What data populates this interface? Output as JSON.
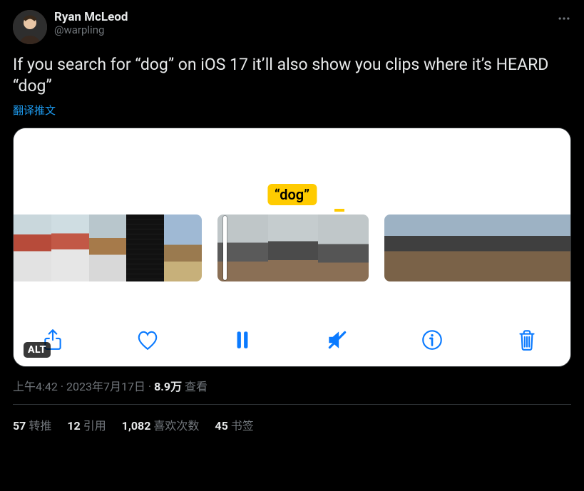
{
  "author": {
    "display_name": "Ryan McLeod",
    "handle": "@warpling"
  },
  "tweet": {
    "text": "If you search for “dog” on iOS 17 it’ll also show you clips where it’s HEARD “dog”",
    "translate_label": "翻译推文",
    "alt_badge": "ALT",
    "search_badge": "“dog”"
  },
  "toolbar_icons": {
    "share": "share-icon",
    "heart": "heart-icon",
    "pause": "pause-icon",
    "mute": "speaker-muted-icon",
    "info": "info-icon",
    "trash": "trash-icon"
  },
  "meta": {
    "time": "上午4:42",
    "date": "2023年7月17日",
    "views_number": "8.9万",
    "views_label": " 查看"
  },
  "stats": {
    "retweets": {
      "n": "57",
      "label": "转推"
    },
    "quotes": {
      "n": "12",
      "label": "引用"
    },
    "likes": {
      "n": "1,082",
      "label": "喜欢次数"
    },
    "bookmarks": {
      "n": "45",
      "label": "书签"
    }
  }
}
